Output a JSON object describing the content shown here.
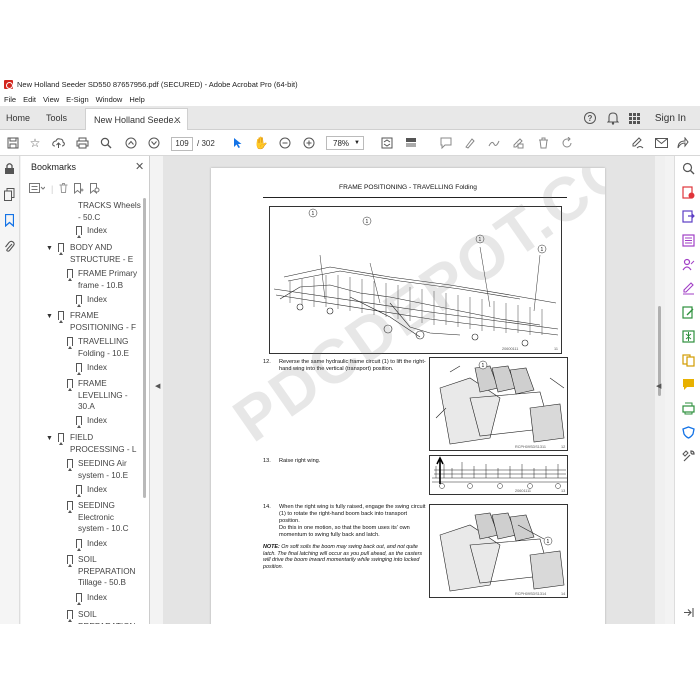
{
  "window": {
    "title": "New Holland Seeder SD550 87657956.pdf (SECURED) - Adobe Acrobat Pro (64-bit)"
  },
  "menu": [
    "File",
    "Edit",
    "View",
    "E-Sign",
    "Window",
    "Help"
  ],
  "tabs": {
    "home": "Home",
    "tools": "Tools",
    "document": "New Holland Seede..."
  },
  "signin": "Sign In",
  "toolbar": {
    "page_current": "109",
    "page_total": "/ 302",
    "zoom": "78%"
  },
  "bookmarks": {
    "title": "Bookmarks",
    "items": [
      {
        "text": "TRACKS Wheels - 50.C"
      },
      {
        "text": "Index"
      },
      {
        "text": "BODY AND STRUCTURE - E"
      },
      {
        "text": "FRAME Primary frame - 10.B"
      },
      {
        "text": "Index"
      },
      {
        "text": "FRAME POSITIONING - F"
      },
      {
        "text": "TRAVELLING Folding - 10.E"
      },
      {
        "text": "Index"
      },
      {
        "text": "FRAME LEVELLING - 30.A"
      },
      {
        "text": "Index"
      },
      {
        "text": "FIELD PROCESSING - L"
      },
      {
        "text": "SEEDING Air system - 10.E"
      },
      {
        "text": "Index"
      },
      {
        "text": "SEEDING Electronic system - 10.C"
      },
      {
        "text": "Index"
      },
      {
        "text": "SOIL PREPARATION Tillage - 50.B"
      },
      {
        "text": "Index"
      },
      {
        "text": "SOIL PREPARATION"
      }
    ]
  },
  "page": {
    "header": "FRAME POSITIONING - TRAVELLING Folding",
    "fig_main_id": "20600111",
    "fig_main_num": "11",
    "step12_num": "12.",
    "step12_text": "Reverse the same hydraulic frame circuit (1) to lift the right-hand wing into the vertical (transport) position.",
    "fig12_id": "RCPH09SDS1311",
    "fig12_num": "12",
    "step13_num": "13.",
    "step13_text": "Raise right wing.",
    "fig13_id": "20601111",
    "fig13_num": "13",
    "step14_num": "14.",
    "step14_text": "When the right wing is fully raised, engage the swing circuit (1) to rotate the right-hand boom back into transport position.",
    "step14_text2": "Do this in one motion, so that the boom uses its' own momentum to swing fully back and latch.",
    "note_label": "NOTE:",
    "note_text": "On soft soils the boom may swing back out, and not quite latch. The final latching will occur as you pull ahead, as the casters will drive the boom inward momentarily while swinging into locked position.",
    "fig14_id": "RCPH09SDS1314",
    "fig14_num": "14",
    "callout": "1",
    "watermark": "PDCDEPOT.COM"
  }
}
